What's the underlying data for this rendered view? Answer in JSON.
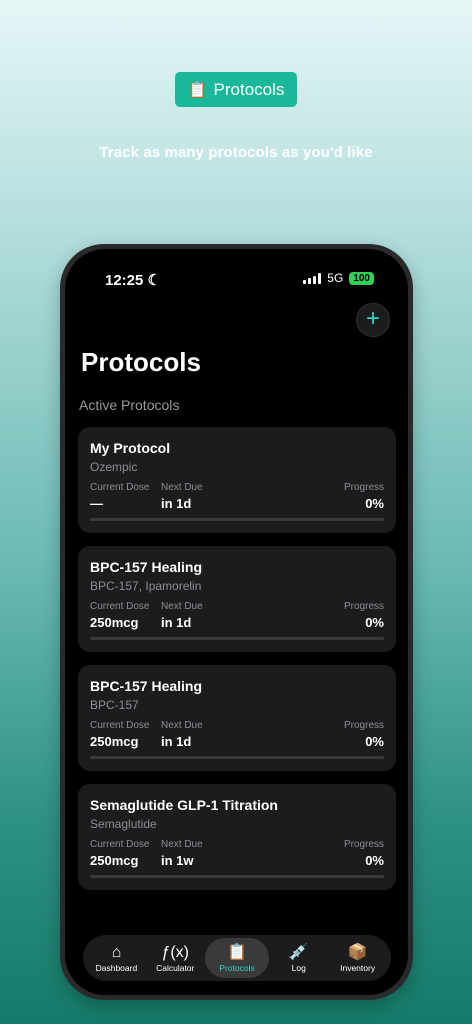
{
  "hero": {
    "badge_icon": "clipboard-icon",
    "badge_icon_glyph": "📋",
    "badge_label": "Protocols",
    "tagline": "Track as many protocols as you'd like"
  },
  "status_bar": {
    "time": "12:25",
    "moon": "☾",
    "network": "5G",
    "battery": "100"
  },
  "header": {
    "add_glyph": "+",
    "title": "Protocols",
    "section": "Active Protocols"
  },
  "labels": {
    "current_dose": "Current Dose",
    "next_due": "Next Due",
    "progress": "Progress"
  },
  "protocols": [
    {
      "name": "My Protocol",
      "compounds": "Ozempic",
      "current_dose": "—",
      "next_due": "in 1d",
      "progress": "0%"
    },
    {
      "name": "BPC-157 Healing",
      "compounds": "BPC-157, Ipamorelin",
      "current_dose": "250mcg",
      "next_due": "in 1d",
      "progress": "0%"
    },
    {
      "name": "BPC-157 Healing",
      "compounds": "BPC-157",
      "current_dose": "250mcg",
      "next_due": "in 1d",
      "progress": "0%"
    },
    {
      "name": "Semaglutide GLP-1 Titration",
      "compounds": "Semaglutide",
      "current_dose": "250mcg",
      "next_due": "in 1w",
      "progress": "0%"
    }
  ],
  "tabs": [
    {
      "label": "Dashboard",
      "icon": "house-icon",
      "glyph": "⌂"
    },
    {
      "label": "Calculator",
      "icon": "function-icon",
      "glyph": "ƒ(x)"
    },
    {
      "label": "Protocols",
      "icon": "clipboard-icon",
      "glyph": "📋"
    },
    {
      "label": "Log",
      "icon": "syringe-icon",
      "glyph": "💉"
    },
    {
      "label": "Inventory",
      "icon": "box-icon",
      "glyph": "📦"
    }
  ],
  "colors": {
    "accent": "#2fd6c4",
    "badge": "#19b89a",
    "card": "#1c1c1e",
    "battery": "#30d158"
  }
}
